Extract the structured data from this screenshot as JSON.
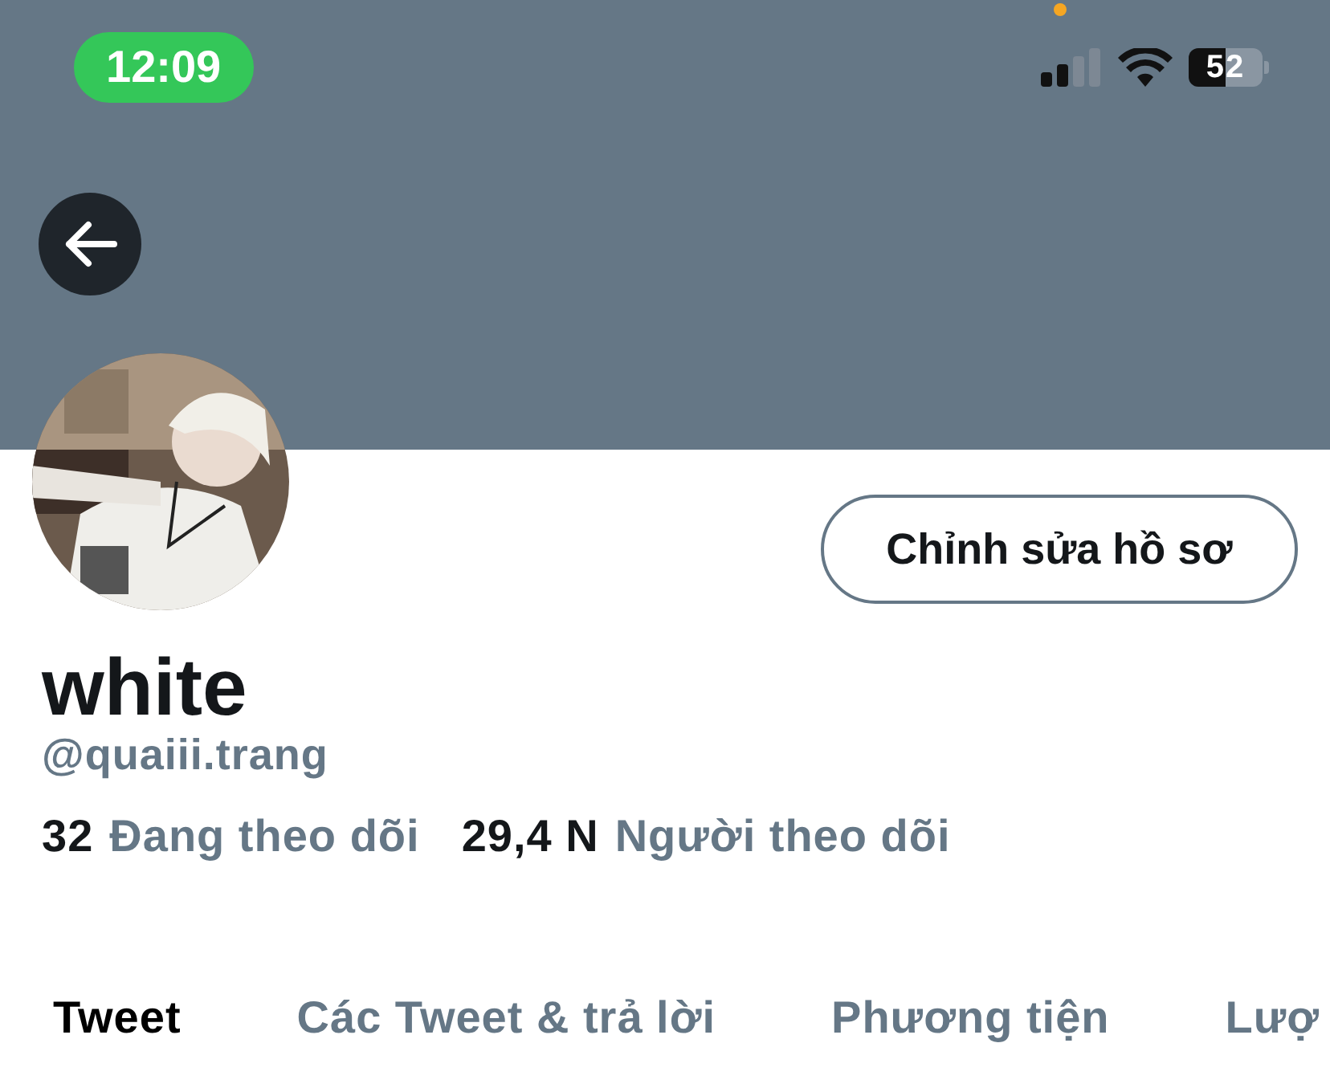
{
  "status_bar": {
    "time": "12:09",
    "battery": "52"
  },
  "profile": {
    "name": "white",
    "handle": "@quaiii.trang",
    "edit_button": "Chỉnh sửa hồ sơ",
    "stats": [
      {
        "count": "32",
        "label": "Đang theo dõi"
      },
      {
        "count": "29,4 N",
        "label": "Người theo dõi"
      }
    ]
  },
  "tabs": [
    {
      "label": "Tweet",
      "selected": true
    },
    {
      "label": "Các Tweet & trả lời",
      "selected": false
    },
    {
      "label": "Phương tiện",
      "selected": false
    },
    {
      "label": "Lượ",
      "selected": false
    }
  ]
}
